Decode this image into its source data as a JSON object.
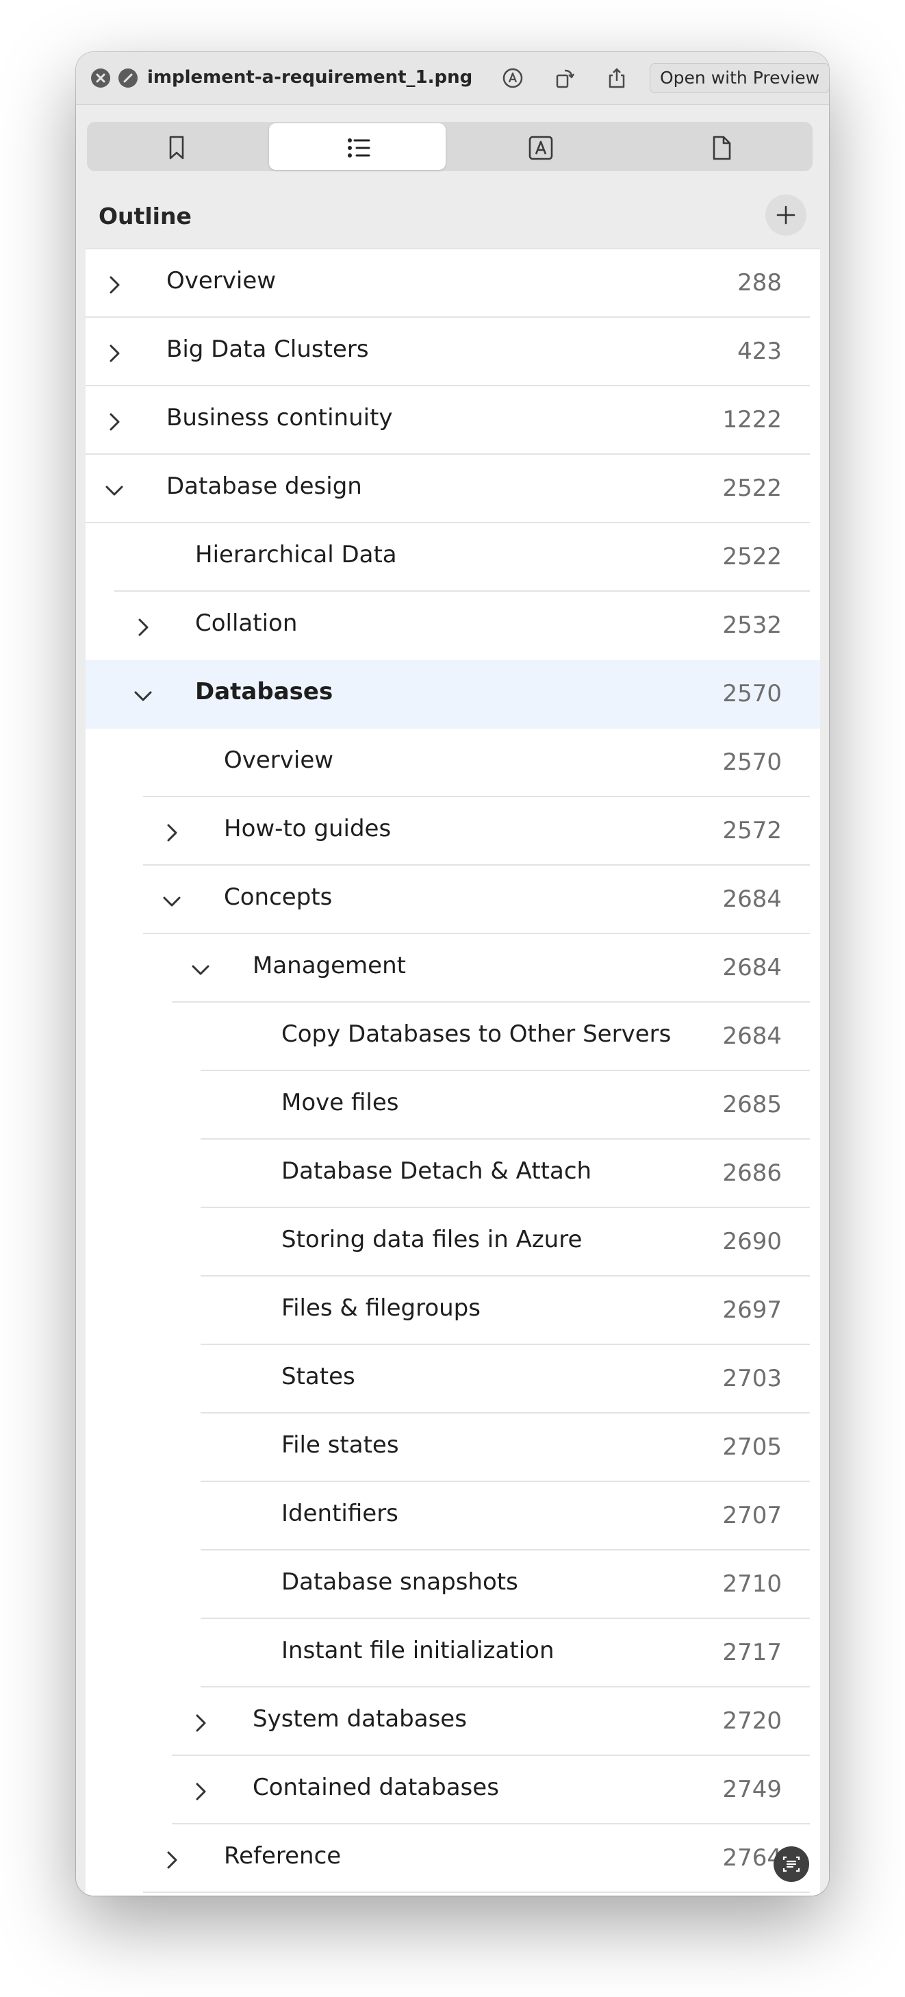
{
  "window": {
    "title": "implement-a-requirement_1.png",
    "open_with_label": "Open with Preview",
    "icons": [
      "close-icon",
      "minimize-icon",
      "markup-icon",
      "rotate-icon",
      "share-icon"
    ]
  },
  "sidebar": {
    "tabs": [
      {
        "name": "bookmarks",
        "icon": "bookmark-icon",
        "active": false
      },
      {
        "name": "outline",
        "icon": "list-icon",
        "active": true
      },
      {
        "name": "annotations",
        "icon": "annotation-icon",
        "active": false
      },
      {
        "name": "thumbnails",
        "icon": "page-icon",
        "active": false
      }
    ],
    "section_title": "Outline",
    "add_icon": "plus-icon"
  },
  "outline": [
    {
      "label": "Overview",
      "page": "288",
      "level": 0,
      "state": "collapsed"
    },
    {
      "label": "Big Data Clusters",
      "page": "423",
      "level": 0,
      "state": "collapsed"
    },
    {
      "label": "Business continuity",
      "page": "1222",
      "level": 0,
      "state": "collapsed"
    },
    {
      "label": "Database design",
      "page": "2522",
      "level": 0,
      "state": "expanded"
    },
    {
      "label": "Hierarchical Data",
      "page": "2522",
      "level": 1,
      "state": "leaf"
    },
    {
      "label": "Collation",
      "page": "2532",
      "level": 1,
      "state": "collapsed"
    },
    {
      "label": "Databases",
      "page": "2570",
      "level": 1,
      "state": "expanded",
      "selected": true
    },
    {
      "label": "Overview",
      "page": "2570",
      "level": 2,
      "state": "leaf"
    },
    {
      "label": "How-to guides",
      "page": "2572",
      "level": 2,
      "state": "collapsed"
    },
    {
      "label": "Concepts",
      "page": "2684",
      "level": 2,
      "state": "expanded"
    },
    {
      "label": "Management",
      "page": "2684",
      "level": 3,
      "state": "expanded"
    },
    {
      "label": "Copy Databases to Other Servers",
      "page": "2684",
      "level": 4,
      "state": "leaf"
    },
    {
      "label": "Move files",
      "page": "2685",
      "level": 4,
      "state": "leaf"
    },
    {
      "label": "Database Detach & Attach",
      "page": "2686",
      "level": 4,
      "state": "leaf"
    },
    {
      "label": "Storing data files in Azure",
      "page": "2690",
      "level": 4,
      "state": "leaf"
    },
    {
      "label": "Files & filegroups",
      "page": "2697",
      "level": 4,
      "state": "leaf"
    },
    {
      "label": "States",
      "page": "2703",
      "level": 4,
      "state": "leaf"
    },
    {
      "label": "File states",
      "page": "2705",
      "level": 4,
      "state": "leaf"
    },
    {
      "label": "Identifiers",
      "page": "2707",
      "level": 4,
      "state": "leaf"
    },
    {
      "label": "Database snapshots",
      "page": "2710",
      "level": 4,
      "state": "leaf"
    },
    {
      "label": "Instant file initialization",
      "page": "2717",
      "level": 4,
      "state": "leaf"
    },
    {
      "label": "System databases",
      "page": "2720",
      "level": 3,
      "state": "collapsed"
    },
    {
      "label": "Contained databases",
      "page": "2749",
      "level": 3,
      "state": "collapsed"
    },
    {
      "label": "Reference",
      "page": "2764",
      "level": 2,
      "state": "collapsed"
    }
  ],
  "colors": {
    "selected_row": "#eef4fd",
    "page_number": "#6e6e6e"
  },
  "corner_icon": "live-text-icon"
}
